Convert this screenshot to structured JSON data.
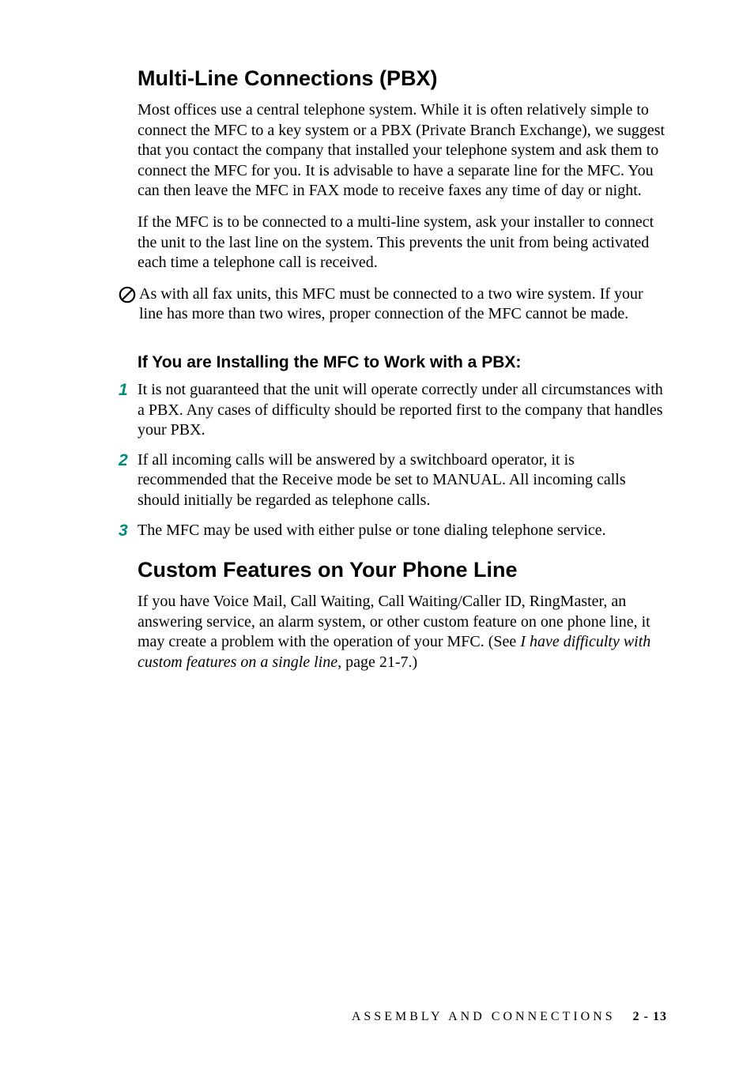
{
  "section1": {
    "heading": "Multi-Line Connections (PBX)",
    "para1": "Most offices use a central telephone system. While it is often relatively simple to connect the MFC to a key system or a PBX (Private Branch Exchange), we suggest that you contact the company that installed your telephone system and ask them to connect the MFC for you. It is advisable to have a separate line for the MFC. You can then leave the MFC in FAX mode to receive faxes any time of day or night.",
    "para2": "If the MFC is to be connected to a multi-line system, ask your installer to connect the unit to the last line on the system. This prevents the unit from being activated each time a telephone call is received.",
    "note": "As with all fax units, this MFC must be connected to a two wire system. If your line has more than two wires, proper connection of the MFC cannot be made."
  },
  "subsection": {
    "heading": "If You are Installing the MFC to Work with a PBX:",
    "steps": [
      "It is not guaranteed that the unit will operate correctly under all circumstances with a PBX. Any cases of difficulty should be reported first to the company that handles your PBX.",
      "If all incoming calls will be answered by a switchboard operator, it is recommended that the Receive mode be set to MANUAL. All incoming calls should initially be regarded as telephone calls.",
      "The MFC may be used with either pulse or tone dialing telephone service."
    ]
  },
  "section2": {
    "heading": "Custom Features on Your Phone Line",
    "para_pre": "If you have Voice Mail, Call Waiting, Call Waiting/Caller ID, RingMaster, an answering service, an alarm system, or other custom feature on one phone line, it may create a problem with the operation of your MFC. (See ",
    "para_ref": "I have difficulty with custom features on a single line",
    "para_post": ", page 21-7.)"
  },
  "footer": {
    "section_title": "ASSEMBLY AND CONNECTIONS",
    "page": "2 - 13"
  }
}
